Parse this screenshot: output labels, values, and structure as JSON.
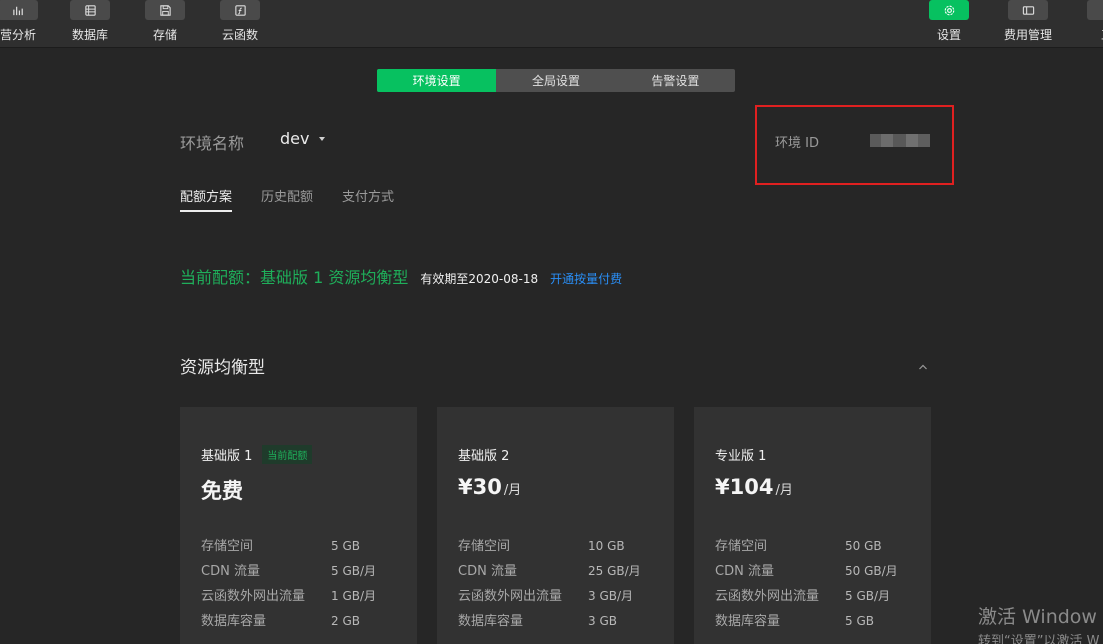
{
  "toolbar": {
    "items": [
      {
        "label": "营分析",
        "icon": "bar-chart-icon"
      },
      {
        "label": "数据库",
        "icon": "database-icon"
      },
      {
        "label": "存储",
        "icon": "save-icon"
      },
      {
        "label": "云函数",
        "icon": "function-icon"
      },
      {
        "label": "设置",
        "icon": "gear-icon",
        "active": true
      },
      {
        "label": "费用管理",
        "icon": "billing-icon"
      },
      {
        "label": "工",
        "icon": "tool-icon"
      }
    ]
  },
  "tabs": {
    "env": "环境设置",
    "global": "全局设置",
    "alert": "告警设置"
  },
  "env": {
    "label": "环境名称",
    "value": "dev",
    "id_label": "环境 ID"
  },
  "subtabs": {
    "quota": "配额方案",
    "history": "历史配额",
    "payment": "支付方式"
  },
  "quota": {
    "current": "当前配额：基础版 1 资源均衡型",
    "valid": "有效期至2020-08-18",
    "link": "开通按量付费"
  },
  "section": {
    "title": "资源均衡型"
  },
  "plans": [
    {
      "name": "基础版 1",
      "badge": "当前配额",
      "price": "免费",
      "unit": "",
      "specs": [
        {
          "k": "存储空间",
          "v": "5 GB"
        },
        {
          "k": "CDN 流量",
          "v": "5 GB/月"
        },
        {
          "k": "云函数外网出流量",
          "v": "1 GB/月"
        },
        {
          "k": "数据库容量",
          "v": "2 GB"
        }
      ]
    },
    {
      "name": "基础版 2",
      "badge": "",
      "price": "¥30",
      "unit": "/月",
      "specs": [
        {
          "k": "存储空间",
          "v": "10 GB"
        },
        {
          "k": "CDN 流量",
          "v": "25 GB/月"
        },
        {
          "k": "云函数外网出流量",
          "v": "3 GB/月"
        },
        {
          "k": "数据库容量",
          "v": "3 GB"
        }
      ]
    },
    {
      "name": "专业版 1",
      "badge": "",
      "price": "¥104",
      "unit": "/月",
      "specs": [
        {
          "k": "存储空间",
          "v": "50 GB"
        },
        {
          "k": "CDN 流量",
          "v": "50 GB/月"
        },
        {
          "k": "云函数外网出流量",
          "v": "5 GB/月"
        },
        {
          "k": "数据库容量",
          "v": "5 GB"
        }
      ]
    }
  ],
  "watermark": {
    "line1": "激活 Window",
    "line2": "转到“设置”以激活 W"
  },
  "colors": {
    "accent": "#07c160",
    "highlight": "#e02020",
    "link": "#2a8ff7"
  }
}
